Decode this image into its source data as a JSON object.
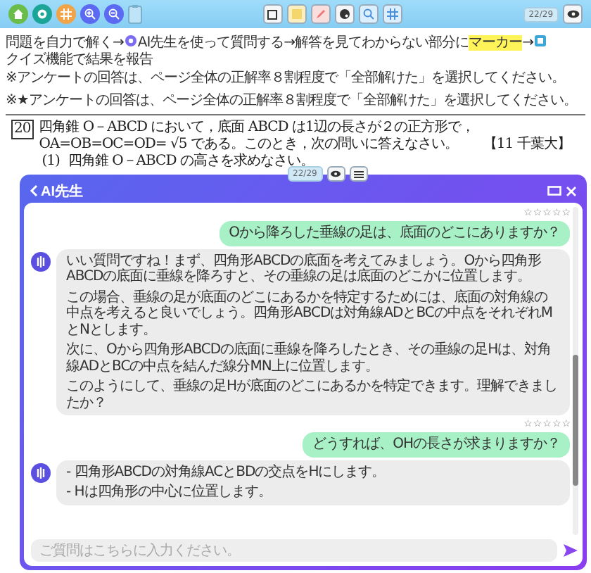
{
  "toolbar": {
    "page_counter": "22/29"
  },
  "instructions": {
    "segments": [
      {
        "kind": "text",
        "text": "問題を自力で解く→"
      },
      {
        "kind": "ai-badge"
      },
      {
        "kind": "text",
        "text": "AI先生を使って質問する→解答を見てわからない部分に"
      },
      {
        "kind": "marker",
        "text": "マーカー"
      },
      {
        "kind": "text",
        "text": "→"
      },
      {
        "kind": "quiz-badge"
      },
      {
        "kind": "text",
        "text": "クイズ機能で結果を報告"
      }
    ],
    "notes": [
      "※アンケートの回答は、ページ全体の正解率８割程度で「全部解けた」を選択してください。",
      "※★アンケートの回答は、ページ全体の正解率８割程度で「全部解けた」を選択してください。"
    ]
  },
  "problem": {
    "number": "20",
    "statement": "四角錐 O－ABCD において，底面 ABCD は1辺の長さが２の正方形で，OA=OB=OC=OD= √5 である。このとき，次の問いに答えなさい。",
    "source": "【11 千葉大】",
    "questions": [
      {
        "label": "(1)",
        "text": "四角錐 O－ABCD の高さを求めなさい。"
      }
    ]
  },
  "chat": {
    "overlay_counter": "22/29",
    "title": "AI先生",
    "messages": [
      {
        "kind": "user",
        "stars": 0,
        "paragraphs": [
          "Oから降ろした垂線の足は、底面のどこにありますか？"
        ]
      },
      {
        "kind": "ai",
        "paragraphs": [
          "いい質問ですね！まず、四角形ABCDの底面を考えてみましょう。Oから四角形ABCDの底面に垂線を降ろすと、その垂線の足は底面のどこかに位置します。",
          "この場合、垂線の足が底面のどこにあるかを特定するためには、底面の対角線の中点を考えると良いでしょう。四角形ABCDは対角線ADとBCの中点をそれぞれMとNとします。",
          "次に、Oから四角形ABCDの底面に垂線を降ろしたとき、その垂線の足Hは、対角線ADとBCの中点を結んだ線分MN上に位置します。",
          "このようにして、垂線の足Hが底面のどこにあるかを特定できます。理解できましたか？"
        ]
      },
      {
        "kind": "user",
        "stars": 0,
        "paragraphs": [
          "どうすれば、OHの長さが求まりますか？"
        ]
      },
      {
        "kind": "ai",
        "paragraphs": [
          "- 四角形ABCDの対角線ACとBDの交点をHにします。",
          "- Hは四角形の中心に位置します。"
        ]
      }
    ],
    "input": {
      "placeholder": "ご質問はこちらに入力ください。"
    }
  }
}
